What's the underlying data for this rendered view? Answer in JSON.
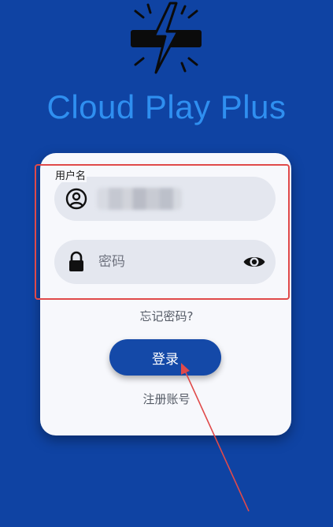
{
  "app": {
    "title": "Cloud Play Plus",
    "logo_icon": "lightning-plug-icon"
  },
  "form": {
    "username": {
      "label": "用户名",
      "icon": "user-circle-icon"
    },
    "password": {
      "placeholder": "密码",
      "icon": "lock-icon",
      "toggle_icon": "eye-icon"
    },
    "forgot_label": "忘记密码?",
    "login_label": "登录",
    "register_label": "注册账号"
  },
  "colors": {
    "background": "#0f43a3",
    "title": "#2f8ff0",
    "card": "#f7f8fc",
    "button": "#1449a8",
    "annotation": "#e04a4a"
  }
}
